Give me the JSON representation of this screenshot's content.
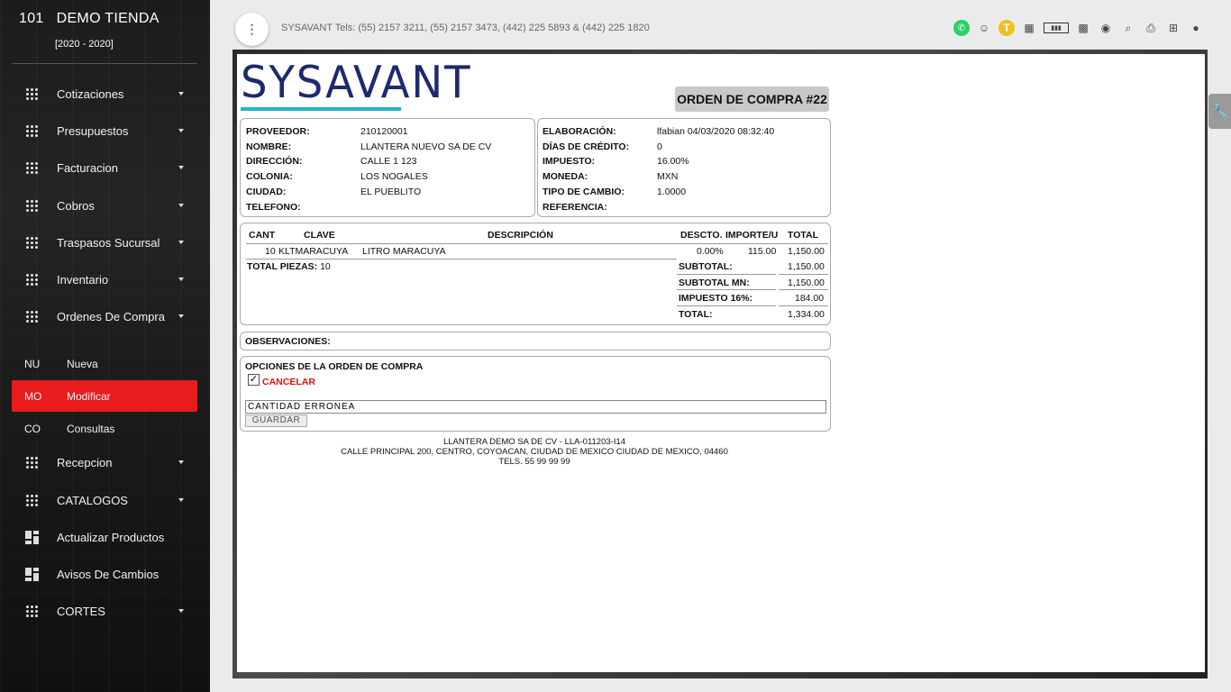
{
  "sidebar": {
    "store_number": "101",
    "store_name": "DEMO TIENDA",
    "period": "[2020 - 2020]",
    "items": [
      {
        "label": "Cotizaciones",
        "icon": "grid-icon"
      },
      {
        "label": "Presupuestos",
        "icon": "grid-icon"
      },
      {
        "label": "Facturacion",
        "icon": "grid-icon"
      },
      {
        "label": "Cobros",
        "icon": "grid-icon"
      },
      {
        "label": "Traspasos Sucursal",
        "icon": "grid-icon"
      },
      {
        "label": "Inventario",
        "icon": "grid-icon"
      },
      {
        "label": "Ordenes De Compra",
        "icon": "grid-icon"
      }
    ],
    "subitems": [
      {
        "abbr": "NU",
        "label": "Nueva"
      },
      {
        "abbr": "MO",
        "label": "Modificar"
      },
      {
        "abbr": "CO",
        "label": "Consultas"
      }
    ],
    "items2": [
      {
        "label": "Recepcion",
        "icon": "grid-icon"
      },
      {
        "label": "CATALOGOS",
        "icon": "grid-icon"
      },
      {
        "label": "Actualizar Productos",
        "icon": "dashboard-icon"
      },
      {
        "label": "Avisos De Cambios",
        "icon": "dashboard-icon"
      },
      {
        "label": "CORTES",
        "icon": "grid-icon"
      }
    ]
  },
  "topbar": {
    "menu_glyph": "⋮",
    "tels": "SYSAVANT Tels: (55) 2157 3211, (55) 2157 3473, (442) 225 5893 & (442) 225 1820",
    "badge_letter": "T"
  },
  "document": {
    "logo_text": "SYSAVANT",
    "title": "ORDEN DE COMPRA #22",
    "proveedor": {
      "labels": [
        "PROVEEDOR:",
        "NOMBRE:",
        "DIRECCIÓN:",
        "COLONIA:",
        "CIUDAD:",
        "TELEFONO:"
      ],
      "values": [
        "210120001",
        "LLANTERA NUEVO SA DE CV",
        "CALLE 1 123",
        "LOS NOGALES",
        "EL PUEBLITO",
        ""
      ]
    },
    "orden": {
      "labels": [
        "ELABORACIÓN:",
        "DÍAS DE CRÉDITO:",
        "IMPUESTO:",
        "MONEDA:",
        "TIPO DE CAMBIO:",
        "REFERENCIA:"
      ],
      "values": [
        "lfabian 04/03/2020 08:32:40",
        "0",
        "16.00%",
        "MXN",
        "1.0000",
        ""
      ]
    },
    "table": {
      "headers": [
        "CANT",
        "CLAVE",
        "DESCRIPCIÓN",
        "DESCTO.",
        "IMPORTE/U",
        "TOTAL"
      ],
      "row": {
        "cant": "10",
        "clave": "KLTMARACUYA",
        "descripcion": "LITRO MARACUYA",
        "descto": "0.00%",
        "importe": "115.00",
        "total": "1,150.00"
      },
      "total_piezas_label": "TOTAL PIEZAS:",
      "total_piezas": "10",
      "summary_labels": [
        "SUBTOTAL:",
        "SUBTOTAL MN:",
        "IMPUESTO 16%:",
        "TOTAL:"
      ],
      "summary_values": [
        "1,150.00",
        "1,150.00",
        "184.00",
        "1,334.00"
      ]
    },
    "observaciones_label": "OBSERVACIONES:",
    "opciones_title": "OPCIONES DE LA ORDEN DE COMPRA",
    "cancel_checked": "✓",
    "cancel_label": "CANCELAR",
    "motivo_value": "CANTIDAD ERRONEA",
    "guardar_label": "GUARDAR",
    "footer": [
      "LLANTERA DEMO SA DE CV - LLA-011203-I14",
      "CALLE PRINCIPAL 200, CENTRO, COYOACAN, CIUDAD DE MEXICO CIUDAD DE MEXICO, 04460",
      "TELS. 55 99 99 99"
    ]
  },
  "colors": {
    "active": "#e81c1c",
    "logo": "#1d2a6d",
    "logo_bar": "#27b3c8",
    "cancel": "#e01010"
  }
}
